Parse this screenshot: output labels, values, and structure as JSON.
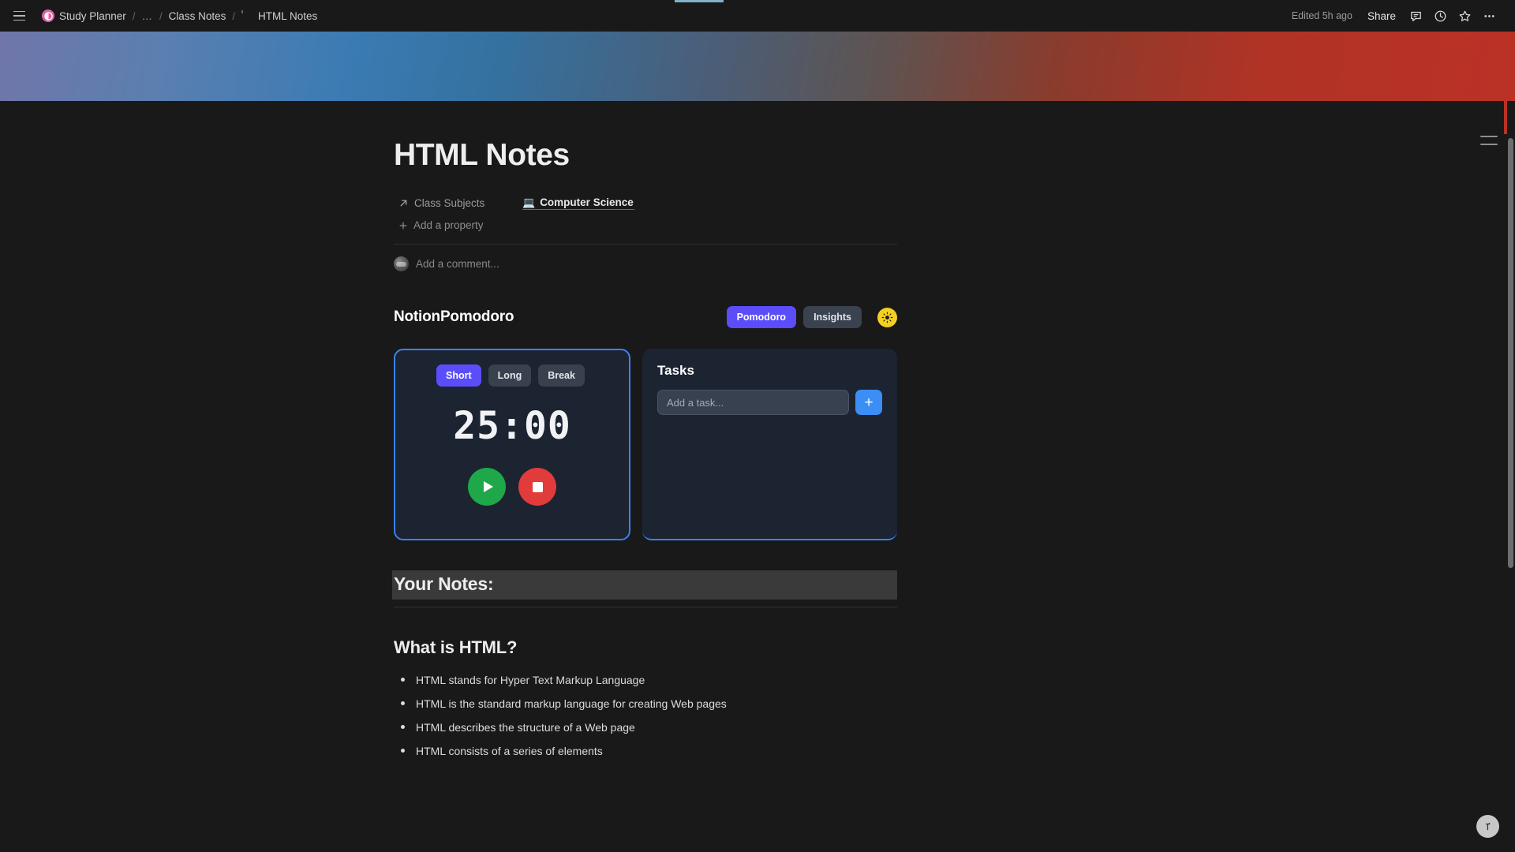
{
  "topbar": {
    "menu_icon": "hamburger-menu-icon",
    "breadcrumb": [
      {
        "label": "Study Planner",
        "icon": "workspace-contrast-icon"
      },
      {
        "label": "…",
        "icon": "ellipsis-icon"
      },
      {
        "label": "Class Notes",
        "icon": null
      },
      {
        "label": "HTML Notes",
        "icon": "notebook-emoji"
      }
    ],
    "separator": "/",
    "edited_text": "Edited 5h ago",
    "share_label": "Share",
    "actions": [
      {
        "name": "comments-icon"
      },
      {
        "name": "updates-history-icon"
      },
      {
        "name": "favorite-star-icon"
      },
      {
        "name": "more-options-icon"
      }
    ]
  },
  "cover": {
    "gradient_from": "#7076a9",
    "gradient_mid": "#3b7bb4",
    "gradient_to": "#bb3126"
  },
  "page": {
    "emoji": "notebook-emoji",
    "title": "HTML Notes",
    "properties": [
      {
        "label": "Class Subjects",
        "icon": "relation-arrow-icon",
        "value": "Computer Science",
        "value_icon": "laptop-emoji"
      }
    ],
    "add_property_label": "Add a property",
    "comment_placeholder": "Add a comment..."
  },
  "pomodoro": {
    "app_title": "NotionPomodoro",
    "tabs": [
      {
        "label": "Pomodoro",
        "active": true
      },
      {
        "label": "Insights",
        "active": false
      }
    ],
    "theme_toggle_icon": "sun-icon",
    "accent_purple": "#5b4dfa",
    "accent_blue": "#3b82f6",
    "timer": {
      "modes": [
        {
          "label": "Short",
          "active": true
        },
        {
          "label": "Long",
          "active": false
        },
        {
          "label": "Break",
          "active": false
        }
      ],
      "display": "25:00",
      "start_icon": "play-icon",
      "stop_icon": "stop-icon",
      "start_color": "#1fa84a",
      "stop_color": "#e23b3b"
    },
    "tasks": {
      "title": "Tasks",
      "input_value": "",
      "input_placeholder": "Add a task...",
      "add_button_label": "+",
      "items": []
    }
  },
  "notes": {
    "section_heading": "Your Notes:",
    "article_heading": "What is HTML?",
    "bullets": [
      "HTML stands for Hyper Text Markup Language",
      "HTML is the standard markup language for creating Web pages",
      "HTML describes the structure of a Web page",
      "HTML consists of a series of elements"
    ]
  },
  "rail": {
    "toc_icon": "table-of-contents-icon",
    "help_label": "?"
  }
}
